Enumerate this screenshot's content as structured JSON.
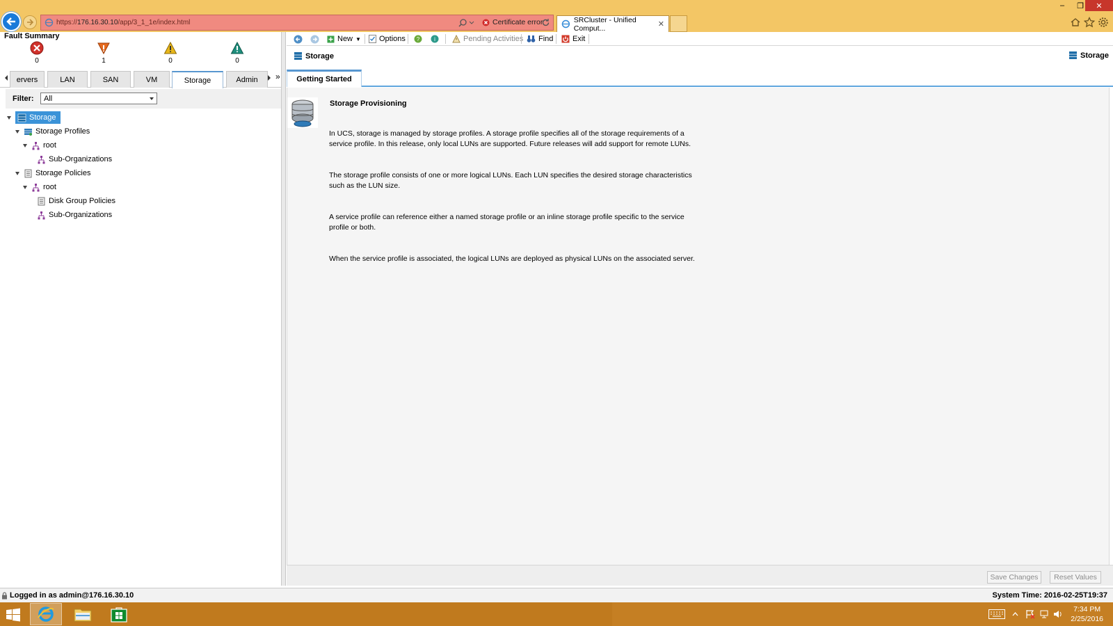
{
  "browser": {
    "url_prefix": "https://",
    "url_host": "176.16.30.10",
    "url_path": "/app/3_1_1e/index.html",
    "cert_error": "Certificate error",
    "tab_title": "SRCluster - Unified Comput..."
  },
  "fault_summary": {
    "title": "Fault Summary",
    "items": [
      {
        "severity": "critical",
        "count": "0",
        "color": "#d0302a"
      },
      {
        "severity": "major",
        "count": "1",
        "color": "#e56a1f"
      },
      {
        "severity": "minor",
        "count": "0",
        "color": "#e8b71a"
      },
      {
        "severity": "warning",
        "count": "0",
        "color": "#1f8f7d"
      }
    ]
  },
  "nav_tabs": [
    "Servers",
    "LAN",
    "SAN",
    "VM",
    "Storage",
    "Admin"
  ],
  "nav_tab_partial_label": "ervers",
  "active_nav_tab": "Storage",
  "filter": {
    "label": "Filter:",
    "value": "All"
  },
  "tree": [
    {
      "label": "Storage"
    },
    {
      "label": "Storage Profiles"
    },
    {
      "label": "root"
    },
    {
      "label": "Sub-Organizations"
    },
    {
      "label": "Storage Policies"
    },
    {
      "label": "root"
    },
    {
      "label": "Disk Group Policies"
    },
    {
      "label": "Sub-Organizations"
    }
  ],
  "toolbar": {
    "new_label": "New",
    "options_label": "Options",
    "pending_label": "Pending Activities",
    "find_label": "Find",
    "exit_label": "Exit"
  },
  "page": {
    "title": "Storage",
    "title_right": "Storage",
    "tab": "Getting Started",
    "section_title": "Storage Provisioning",
    "paragraphs": [
      "In UCS, storage is managed by storage profiles. A storage profile specifies all of the storage requirements of a service profile. In this release, only local LUNs are supported. Future releases will add support for remote LUNs.",
      "The storage profile consists of one or more logical LUNs. Each LUN specifies the desired storage characteristics such as the LUN size.",
      "A service profile can reference either a named storage profile or an inline storage profile specific to the service profile or both.",
      "When the service profile is associated, the logical LUNs are deployed as physical LUNs on the associated server."
    ],
    "save_label": "Save Changes",
    "reset_label": "Reset Values"
  },
  "status": {
    "logged_in": "Logged in as admin@176.16.30.10",
    "system_time": "System Time: 2016-02-25T19:37"
  },
  "taskbar": {
    "time": "7:34 PM",
    "date": "2/25/2016"
  },
  "colors": {
    "accent": "#5897d0",
    "selection": "#3b93d8",
    "chrome": "#f3c665",
    "address_error": "#f08a80",
    "taskbar": "#c07a1e"
  }
}
